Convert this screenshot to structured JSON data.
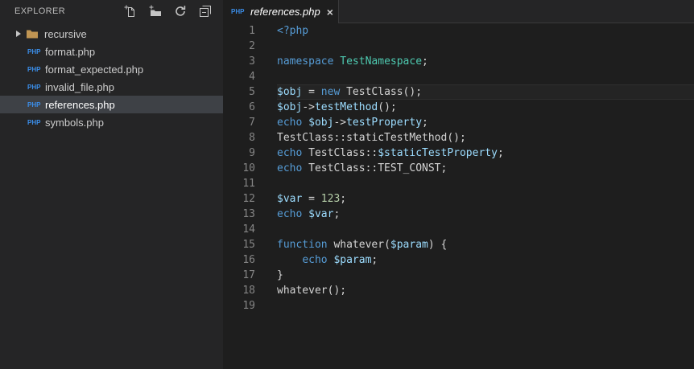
{
  "colors": {
    "editor_bg": "#1e1e1e",
    "sidebar_bg": "#252526",
    "tabbar_bg": "#252526",
    "selected_row_bg": "#3e4146",
    "php_badge": "#3b8eea",
    "folder": "#c09553",
    "icon": "#c5c5c5",
    "keyword": "#569cd6",
    "variable": "#9cdcfe",
    "class_name": "#4ec9b0",
    "plain": "#d4d4d4",
    "number": "#b5cea8",
    "line_number": "#858585",
    "current_line_bg": "#242424",
    "current_line_border": "#2f2f2f"
  },
  "explorer": {
    "title": "EXPLORER",
    "toolbar": [
      {
        "name": "new-file",
        "icon": "new-file-icon"
      },
      {
        "name": "new-folder",
        "icon": "new-folder-icon"
      },
      {
        "name": "refresh",
        "icon": "refresh-icon"
      },
      {
        "name": "collapse-all",
        "icon": "collapse-all-icon"
      }
    ],
    "file_badge": "PHP",
    "items": [
      {
        "type": "folder",
        "label": "recursive",
        "expanded": false,
        "selected": false
      },
      {
        "type": "file",
        "label": "format.php",
        "selected": false
      },
      {
        "type": "file",
        "label": "format_expected.php",
        "selected": false
      },
      {
        "type": "file",
        "label": "invalid_file.php",
        "selected": false
      },
      {
        "type": "file",
        "label": "references.php",
        "selected": true
      },
      {
        "type": "file",
        "label": "symbols.php",
        "selected": false
      }
    ]
  },
  "tab": {
    "title": "references.php",
    "badge": "PHP",
    "close_glyph": "×",
    "active": true,
    "preview": true
  },
  "editor": {
    "current_line": 5,
    "lines": [
      {
        "n": 1,
        "tokens": [
          [
            "<?php",
            "kw"
          ]
        ]
      },
      {
        "n": 2,
        "tokens": []
      },
      {
        "n": 3,
        "tokens": [
          [
            "namespace",
            "kw"
          ],
          [
            " ",
            "pl"
          ],
          [
            "TestNamespace",
            "cl"
          ],
          [
            ";",
            "pl"
          ]
        ]
      },
      {
        "n": 4,
        "tokens": []
      },
      {
        "n": 5,
        "tokens": [
          [
            "$obj",
            "var"
          ],
          [
            " = ",
            "pl"
          ],
          [
            "new",
            "kw"
          ],
          [
            " TestClass();",
            "pl"
          ]
        ]
      },
      {
        "n": 6,
        "tokens": [
          [
            "$obj",
            "var"
          ],
          [
            "->",
            "pl"
          ],
          [
            "testMethod",
            "var"
          ],
          [
            "();",
            "pl"
          ]
        ]
      },
      {
        "n": 7,
        "tokens": [
          [
            "echo",
            "kw"
          ],
          [
            " ",
            "pl"
          ],
          [
            "$obj",
            "var"
          ],
          [
            "->",
            "pl"
          ],
          [
            "testProperty",
            "var"
          ],
          [
            ";",
            "pl"
          ]
        ]
      },
      {
        "n": 8,
        "tokens": [
          [
            "TestClass::staticTestMethod();",
            "pl"
          ]
        ]
      },
      {
        "n": 9,
        "tokens": [
          [
            "echo",
            "kw"
          ],
          [
            " TestClass::",
            "pl"
          ],
          [
            "$staticTestProperty",
            "var"
          ],
          [
            ";",
            "pl"
          ]
        ]
      },
      {
        "n": 10,
        "tokens": [
          [
            "echo",
            "kw"
          ],
          [
            " TestClass::TEST_CONST;",
            "pl"
          ]
        ]
      },
      {
        "n": 11,
        "tokens": []
      },
      {
        "n": 12,
        "tokens": [
          [
            "$var",
            "var"
          ],
          [
            " = ",
            "pl"
          ],
          [
            "123",
            "num"
          ],
          [
            ";",
            "pl"
          ]
        ]
      },
      {
        "n": 13,
        "tokens": [
          [
            "echo",
            "kw"
          ],
          [
            " ",
            "pl"
          ],
          [
            "$var",
            "var"
          ],
          [
            ";",
            "pl"
          ]
        ]
      },
      {
        "n": 14,
        "tokens": []
      },
      {
        "n": 15,
        "tokens": [
          [
            "function",
            "kw"
          ],
          [
            " whatever(",
            "pl"
          ],
          [
            "$param",
            "var"
          ],
          [
            ") {",
            "pl"
          ]
        ]
      },
      {
        "n": 16,
        "tokens": [
          [
            "    ",
            "pl"
          ],
          [
            "echo",
            "kw"
          ],
          [
            " ",
            "pl"
          ],
          [
            "$param",
            "var"
          ],
          [
            ";",
            "pl"
          ]
        ]
      },
      {
        "n": 17,
        "tokens": [
          [
            "}",
            "pl"
          ]
        ]
      },
      {
        "n": 18,
        "tokens": [
          [
            "whatever();",
            "pl"
          ]
        ]
      },
      {
        "n": 19,
        "tokens": []
      }
    ]
  }
}
